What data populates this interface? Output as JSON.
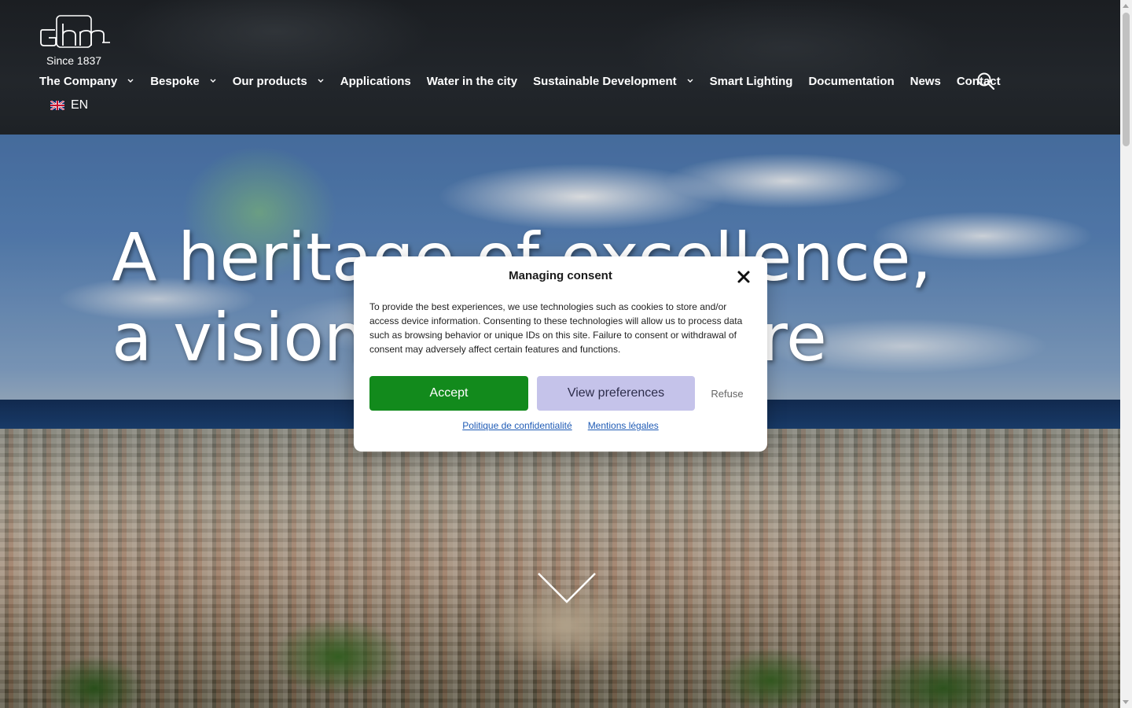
{
  "header": {
    "logo_text": "Ghm",
    "logo_tagline": "Since 1837",
    "nav": [
      {
        "label": "The Company",
        "has_dropdown": true
      },
      {
        "label": "Bespoke",
        "has_dropdown": true
      },
      {
        "label": "Our products",
        "has_dropdown": true
      },
      {
        "label": "Applications",
        "has_dropdown": false
      },
      {
        "label": "Water in the city",
        "has_dropdown": false
      },
      {
        "label": "Sustainable Development",
        "has_dropdown": true
      },
      {
        "label": "Smart Lighting",
        "has_dropdown": false
      },
      {
        "label": "Documentation",
        "has_dropdown": false
      },
      {
        "label": "News",
        "has_dropdown": false
      },
      {
        "label": "Contact",
        "has_dropdown": false
      }
    ],
    "search_icon": "search-icon",
    "language": {
      "code": "EN",
      "flag_icon": "uk-flag-icon"
    }
  },
  "hero": {
    "title_line1": "A heritage of excellence,",
    "title_line2": "a vision for the future",
    "scroll_icon": "chevron-down-icon"
  },
  "consent": {
    "title": "Managing consent",
    "close_icon": "close-icon",
    "body": "To provide the best experiences, we use technologies such as cookies to store and/or access device information. Consenting to these technologies will allow us to process data such as browsing behavior or unique IDs on this site. Failure to consent or withdrawal of consent may adversely affect certain features and functions.",
    "accept_label": "Accept",
    "preferences_label": "View preferences",
    "refuse_label": "Refuse",
    "links": {
      "privacy": "Politique de confidentialité",
      "legal": "Mentions légales"
    }
  },
  "colors": {
    "accept_button": "#128a1c",
    "preferences_button": "#c5c3ea",
    "link": "#1f5bb5",
    "header_background": "#1e2226"
  }
}
